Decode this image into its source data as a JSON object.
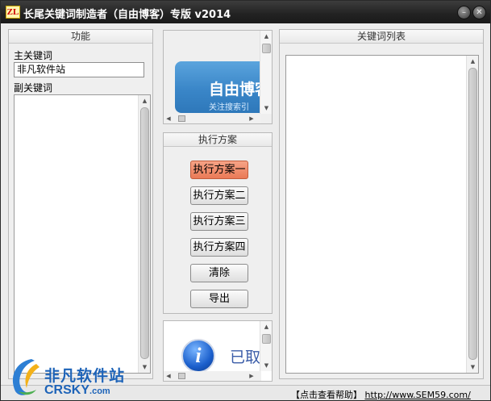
{
  "window": {
    "app_icon_text": "ZL",
    "title": "长尾关键词制造者（自由博客）专版 v2014",
    "minimize_glyph": "–",
    "close_glyph": "✕"
  },
  "function_panel": {
    "heading": "功能",
    "main_keyword_label": "主关键词",
    "main_keyword_value": "非凡软件站",
    "sub_keyword_label": "副关键词"
  },
  "ad_top": {
    "headline": "自由博客",
    "tagline": "关注搜索引"
  },
  "plan_panel": {
    "heading": "执行方案",
    "buttons": [
      "执行方案一",
      "执行方案二",
      "执行方案三",
      "执行方案四",
      "清除",
      "导出"
    ],
    "active_index": 0
  },
  "ad_bottom": {
    "icon_letter": "i",
    "text": "已取"
  },
  "keyword_panel": {
    "heading": "关键词列表"
  },
  "status": {
    "help_text": "【点击查看帮助】",
    "url": "http://www.SEM59.com/"
  },
  "watermark": {
    "cn": "非凡软件站",
    "en": "CRSKY",
    "suffix": ".com"
  },
  "colors": {
    "active_button": "#ea7a56",
    "title_bar": "#2a2a2a",
    "banner_blue": "#3a86c8"
  }
}
